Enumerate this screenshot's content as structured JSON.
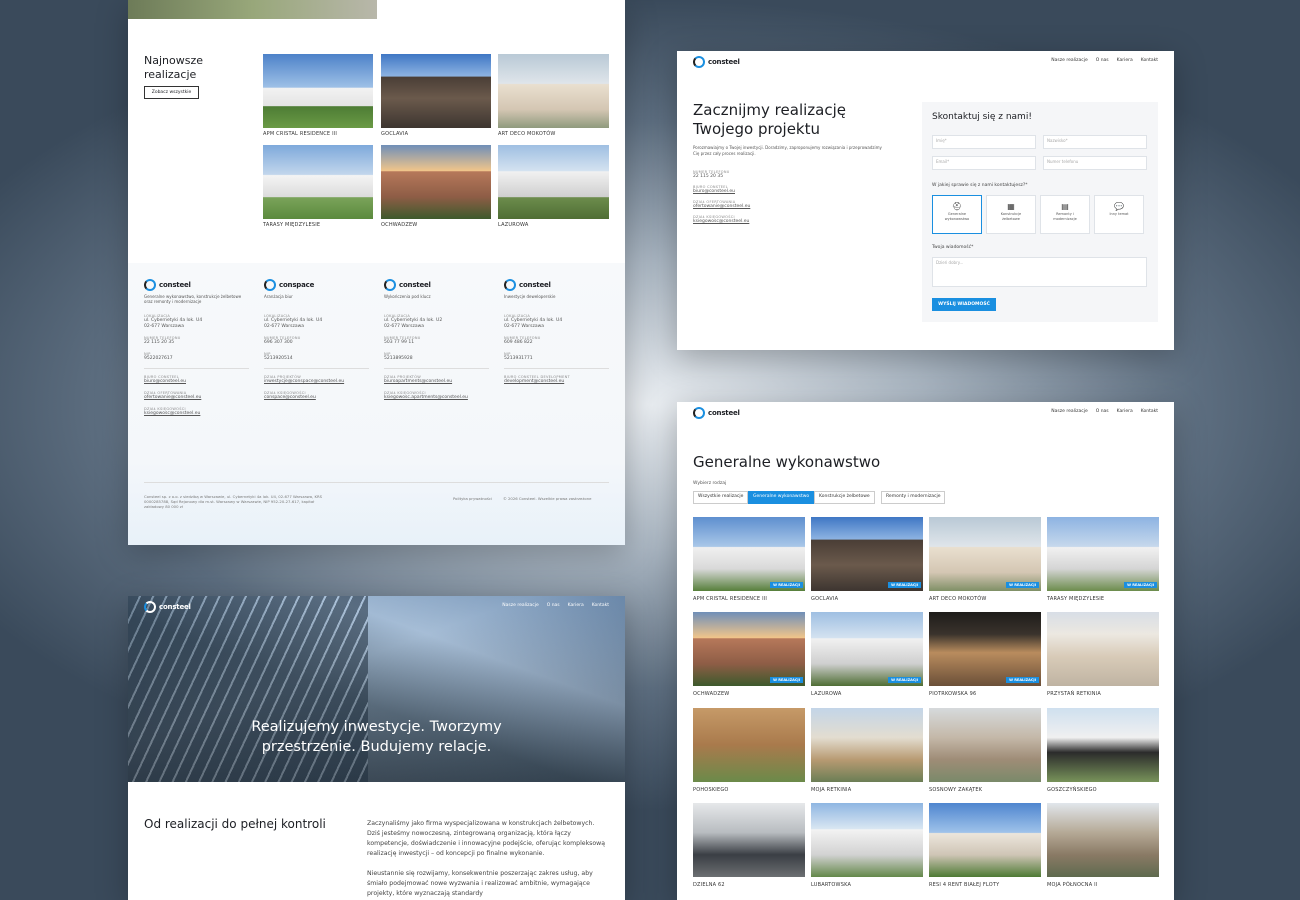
{
  "p1": {
    "heading": "Najnowsze realizacje",
    "button": "Zobacz wszystkie",
    "items": [
      "APM CRISTAL RESIDENCE III",
      "GOCLAVIA",
      "ART DECO MOKOTÓW",
      "TARASY MIĘDZYLESIE",
      "OCHWADZEW",
      "LAZUROWA"
    ],
    "companies": [
      {
        "logo": "consteel",
        "desc": "Generalne wykonawstwo, konstrukcje żelbetowe oraz remonty i modernizacje",
        "loc_label": "LOKALIZACJA",
        "addr1": "ul. Cybernetyki 4a lok. U4",
        "addr2": "02-677 Warszawa",
        "phone_label": "NUMER TELEFONU",
        "phone": "22 115 20 35",
        "nip_label": "NIP",
        "nip": "9522027617",
        "extra": [
          {
            "label": "BIURO CONSTEEL",
            "value": "biuro@consteel.eu"
          },
          {
            "label": "DZIAŁ OFERTOWANIA",
            "value": "ofertowanie@consteel.eu"
          },
          {
            "label": "DZIAŁ KSIĘGOWOŚCI",
            "value": "ksiegowosc@consteel.eu"
          }
        ]
      },
      {
        "logo": "conspace",
        "desc": "Aranżacja biur",
        "loc_label": "LOKALIZACJA",
        "addr1": "ul. Cybernetyki 4a lok. U4",
        "addr2": "02-677 Warszawa",
        "phone_label": "NUMER TELEFONU",
        "phone": "696 307 300",
        "nip_label": "NIP",
        "nip": "5213920514",
        "extra": [
          {
            "label": "DZIAŁ PROJEKTÓW",
            "value": "inwestycje@conspace@consteel.eu"
          },
          {
            "label": "DZIAŁ KSIĘGOWOŚCI",
            "value": "conspace@consteel.eu"
          }
        ]
      },
      {
        "logo": "consteel",
        "desc": "Wykończenia pod klucz",
        "loc_label": "LOKALIZACJA",
        "addr1": "ul. Cybernetyki 4a lok. U2",
        "addr2": "02-677 Warszawa",
        "phone_label": "NUMER TELEFONU",
        "phone": "503 77 99 11",
        "nip_label": "NIP",
        "nip": "5213895928",
        "extra": [
          {
            "label": "DZIAŁ PROJEKTÓW",
            "value": "biuroapartments@consteel.eu"
          },
          {
            "label": "DZIAŁ KSIĘGOWOŚCI",
            "value": "ksiegowosc.apartments@consteel.eu"
          }
        ]
      },
      {
        "logo": "consteel",
        "desc": "Inwestycje deweloperskie",
        "loc_label": "LOKALIZACJA",
        "addr1": "ul. Cybernetyki 4a lok. U4",
        "addr2": "02-677 Warszawa",
        "phone_label": "NUMER TELEFONU",
        "phone": "609 486 822",
        "nip_label": "NIP",
        "nip": "5213931771",
        "extra": [
          {
            "label": "BIURO CONSTEEL DEVELOPMENT",
            "value": "development@consteel.eu"
          }
        ]
      }
    ],
    "footer_left": "Consteel sp. z o.o. z siedzibą w Warszawie, ul. Cybernetyki 4a lok. U4, 02-677 Warszawa, KRS 0000285788, Sąd Rejonowy dla m.st. Warszawy w Warszawie, NIP 952-20-27-617, kapitał zakładowy 80 000 zł",
    "footer_policy": "Polityka prywatności",
    "footer_copy": "© 2026 Consteel. Wszelkie prawa zastrzeżone"
  },
  "p2": {
    "logo": "consteel",
    "nav": [
      "Nasze realizacje",
      "O nas",
      "Kariera",
      "Kontakt"
    ],
    "heading": "Zacznijmy realizację Twojego projektu",
    "intro": "Porozmawiajmy o Twojej inwestycji. Doradzimy, zaproponujemy rozwiązania i przeprowadzimy Cię przez cały proces realizacji.",
    "contacts": [
      {
        "label": "NUMER TELEFONU",
        "value": "22 115 20 35"
      },
      {
        "label": "BIURO CONSTEEL",
        "value": "biuro@consteel.eu"
      },
      {
        "label": "DZIAŁ OFERTOWANIA",
        "value": "ofertowanie@consteel.eu"
      },
      {
        "label": "DZIAŁ KSIĘGOWOŚCI",
        "value": "ksiegowosc@consteel.eu"
      }
    ],
    "form_title": "Skontaktuj się z nami!",
    "ph_name": "Imię*",
    "ph_surname": "Nazwisko*",
    "ph_email": "Email*",
    "ph_phone": "Numer telefonu",
    "question": "W jakiej sprawie się z nami kontaktujesz?*",
    "options": [
      "Generalne wykonawstwo",
      "Konstrukcje żelbetowe",
      "Remonty i modernizacje",
      "Inny temat"
    ],
    "msg_label": "Twoja wiadomość*",
    "msg_ph": "Dzień dobry...",
    "submit": "WYŚLIJ WIADOMOŚĆ"
  },
  "p3": {
    "nav": [
      "Nasze realizacje",
      "O nas",
      "Kariera",
      "Kontakt"
    ],
    "hero": "Realizujemy inwestycje. Tworzymy przestrzenie. Budujemy relacje.",
    "section_title": "Od realizacji do pełnej kontroli",
    "para1": "Zaczynaliśmy jako firma wyspecjalizowana w konstrukcjach żelbetowych. Dziś jesteśmy nowoczesną, zintegrowaną organizacją, która łączy kompetencje, doświadczenie i innowacyjne podejście, oferując kompleksową realizację inwestycji – od koncepcji po finalne wykonanie.",
    "para2": "Nieustannie się rozwijamy, konsekwentnie poszerzając zakres usług, aby śmiało podejmować nowe wyzwania i realizować ambitnie, wymagające projekty, które wyznaczają standardy"
  },
  "p4": {
    "nav": [
      "Nasze realizacje",
      "O nas",
      "Kariera",
      "Kontakt"
    ],
    "heading": "Generalne wykonawstwo",
    "filter_label": "Wybierz rodzaj",
    "tabs": [
      "Wszystkie realizacje",
      "Generalne wykonawstwo",
      "Konstrukcje żelbetowe",
      "Remonty i modernizacje"
    ],
    "badge": "W REALIZACJI",
    "items": [
      "APM CRISTAL RESIDENCE III",
      "GOCLAVIA",
      "ART DECO MOKOTÓW",
      "TARASY MIĘDZYLESIE",
      "OCHWADZEW",
      "LAZUROWA",
      "PIOTRKOWSKA 96",
      "PRZYSTAŃ RETKINIA",
      "POHOSKIEGO",
      "MOJA RETKINIA",
      "SOSNOWY ZAKĄTEK",
      "GOSZCZYŃSKIEGO",
      "DZIELNA 62",
      "LUBARTOWSKA",
      "RESI 4 RENT BIAŁEJ FLOTY",
      "MOJA PÓŁNOCNA II"
    ]
  },
  "colors": {
    "accent": "#1a8fe0",
    "dark": "#1d1f24"
  }
}
